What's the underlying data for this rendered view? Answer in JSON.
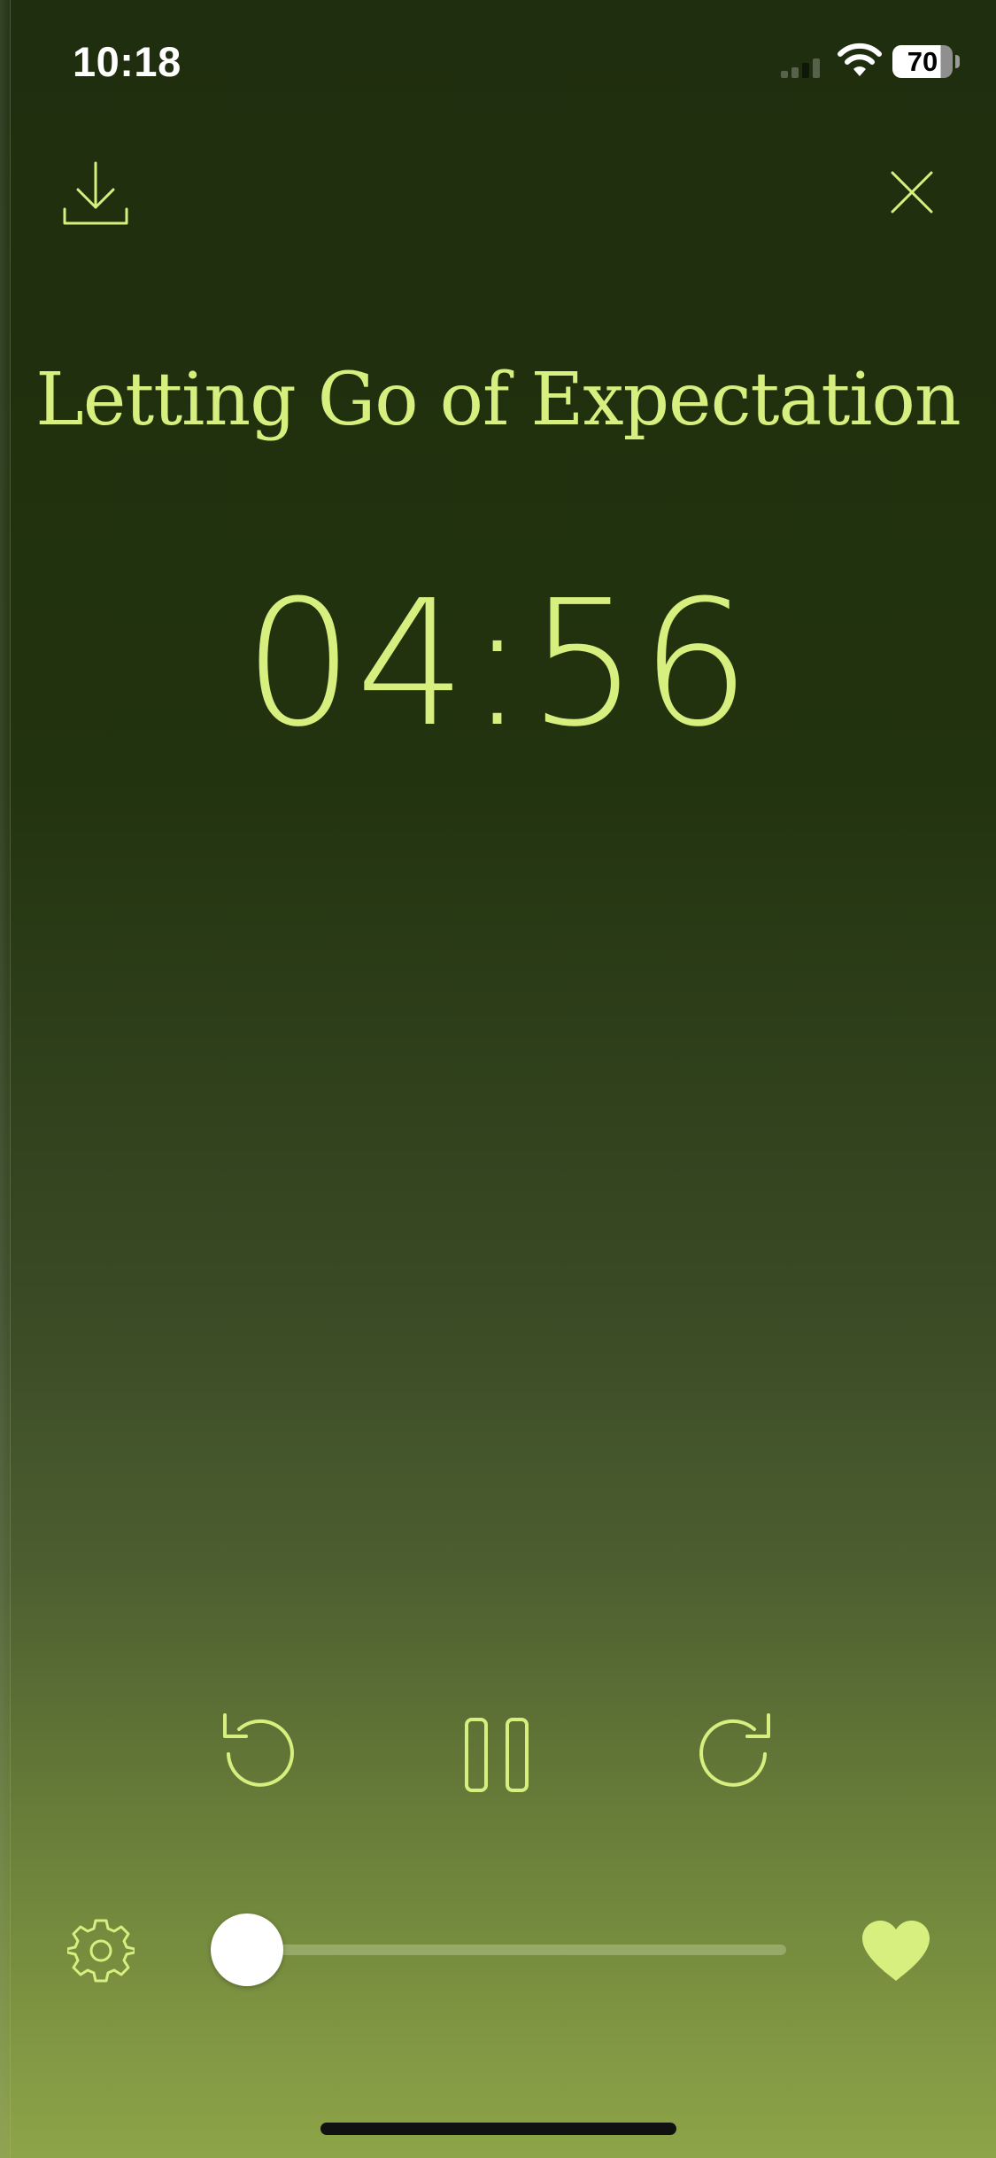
{
  "status_bar": {
    "time": "10:18",
    "battery_level": "70",
    "signal_icon": "cell-signal-icon",
    "wifi_icon": "wifi-icon"
  },
  "header": {
    "download_icon": "download-icon",
    "close_icon": "close-icon"
  },
  "session": {
    "title": "Letting Go of Expectation",
    "time_remaining": "04:56"
  },
  "controls": {
    "rewind_icon": "rewind-icon",
    "pause_icon": "pause-icon",
    "forward_icon": "forward-icon"
  },
  "bottom_bar": {
    "settings_icon": "gear-icon",
    "progress": 0.02,
    "favorite_icon": "heart-icon"
  },
  "colors": {
    "accent": "#d6ef7f",
    "background_top": "#1f2e0e",
    "background_bottom": "#8ea448",
    "slider_thumb": "#ffffff"
  }
}
